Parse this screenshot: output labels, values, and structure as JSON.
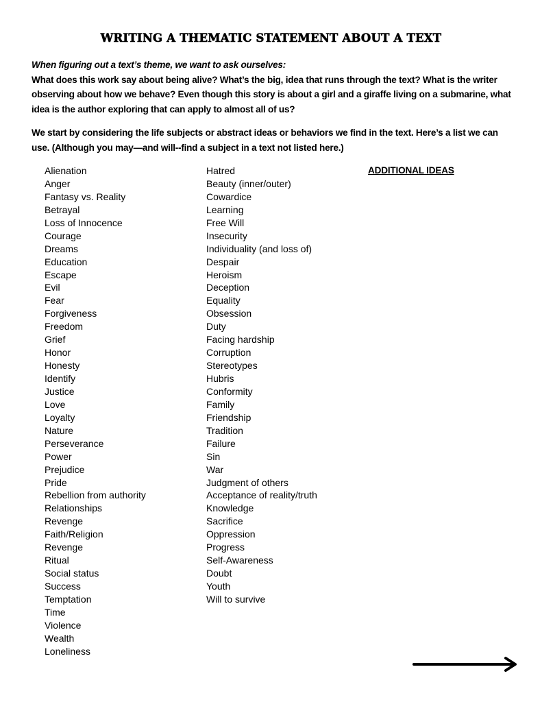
{
  "title": "WRITING A THEMATIC STATEMENT ABOUT A TEXT",
  "intro": {
    "italic_lead": "When figuring out a text’s theme, we want to ask ourselves:",
    "questions": "What does this work say about being alive? What’s the big, idea that runs through the text?  What is the writer observing about how we behave? Even though this story is about a girl and a giraffe living on a submarine, what idea is the author exploring that can apply to almost all of us?",
    "list_intro": "We start by considering the life subjects or abstract ideas or behaviors we find in the text. Here’s a list we can use. (Although you may—and will--find a subject in a text not listed here.)"
  },
  "column1": [
    "Alienation",
    "Anger",
    "Fantasy vs. Reality",
    "Betrayal",
    "Loss of Innocence",
    "Courage",
    "Dreams",
    "Education",
    "Escape",
    "Evil",
    "Fear",
    "Forgiveness",
    "Freedom",
    "Grief",
    "Honor",
    "Honesty",
    "Identify",
    "Justice",
    "Love",
    "Loyalty",
    "Nature",
    "Perseverance",
    "Power",
    "Prejudice",
    "Pride",
    "Rebellion from authority",
    "Relationships",
    "Revenge",
    "Faith/Religion",
    "Revenge",
    "Ritual",
    "Social status",
    "Success",
    "Temptation",
    "Time",
    "Violence",
    "Wealth",
    "Loneliness"
  ],
  "column2": [
    "Hatred",
    "Beauty (inner/outer)",
    "Cowardice",
    "Learning",
    "Free Will",
    "Insecurity",
    "Individuality (and loss of)",
    "Despair",
    "Heroism",
    "Deception",
    "Equality",
    "Obsession",
    "Duty",
    "Facing hardship",
    "Corruption",
    "Stereotypes",
    "Hubris",
    "Conformity",
    "Family",
    "Friendship",
    "Tradition",
    "Failure",
    "Sin",
    "War",
    "Judgment of others",
    "Acceptance of reality/truth",
    "Knowledge",
    "Sacrifice",
    "Oppression",
    "Progress",
    "Self-Awareness",
    "Doubt",
    "Youth",
    "Will to survive"
  ],
  "additional_ideas_heading": "ADDITIONAL IDEAS",
  "arrow_icon": "right-arrow"
}
